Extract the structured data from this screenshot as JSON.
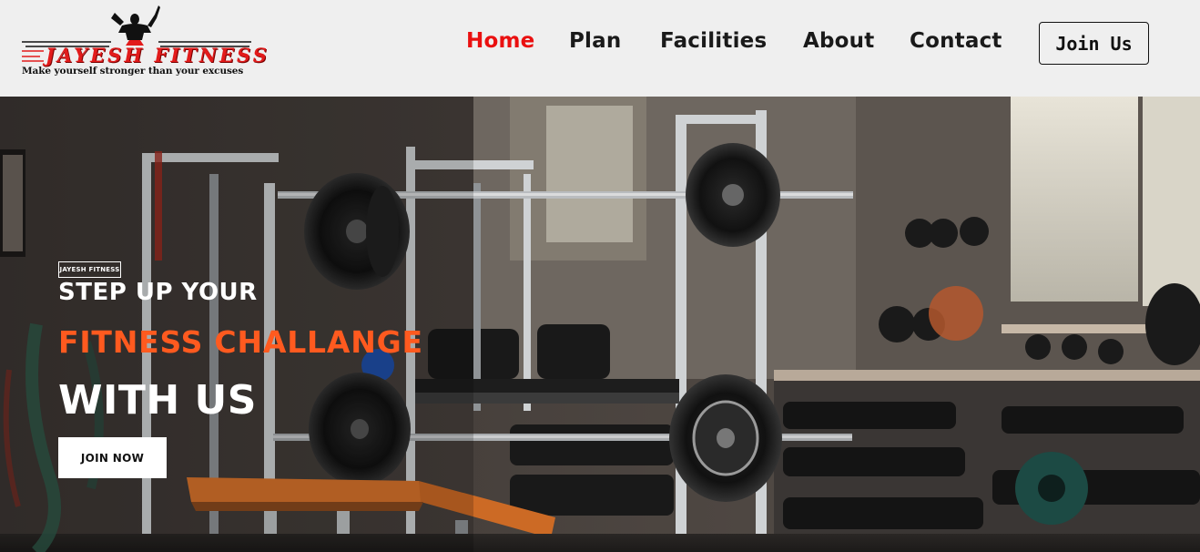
{
  "brand": {
    "name": "JAYESH FITNESS",
    "tagline": "Make yourself stronger than your excuses"
  },
  "nav": {
    "items": [
      {
        "label": "Home",
        "active": true
      },
      {
        "label": "Plan",
        "active": false
      },
      {
        "label": "Facilities",
        "active": false
      },
      {
        "label": "About",
        "active": false
      },
      {
        "label": "Contact",
        "active": false
      }
    ],
    "cta_label": "Join Us"
  },
  "hero": {
    "badge": "JAYESH FITNESS",
    "line1": "STEP UP YOUR",
    "line2": "FITNESS CHALLANGE",
    "line3": "WITH US",
    "button_label": "JOIN NOW",
    "background_image": "gym-interior-with-barbells"
  },
  "colors": {
    "accent_red": "#ea1010",
    "accent_orange": "#ff5a1f",
    "header_bg": "#efefef"
  }
}
